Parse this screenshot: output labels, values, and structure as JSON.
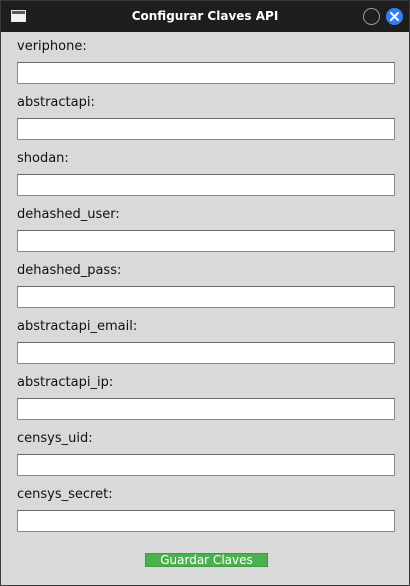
{
  "window": {
    "title": "Configurar Claves API",
    "minimize_icon": "circle-icon",
    "close_icon": "close-icon",
    "close_color": "#2f7ff5"
  },
  "fields": [
    {
      "key": "veriphone",
      "label": "veriphone:",
      "value": ""
    },
    {
      "key": "abstractapi",
      "label": "abstractapi:",
      "value": ""
    },
    {
      "key": "shodan",
      "label": "shodan:",
      "value": ""
    },
    {
      "key": "dehashed_user",
      "label": "dehashed_user:",
      "value": ""
    },
    {
      "key": "dehashed_pass",
      "label": "dehashed_pass:",
      "value": ""
    },
    {
      "key": "abstractapi_email",
      "label": "abstractapi_email:",
      "value": ""
    },
    {
      "key": "abstractapi_ip",
      "label": "abstractapi_ip:",
      "value": ""
    },
    {
      "key": "censys_uid",
      "label": "censys_uid:",
      "value": ""
    },
    {
      "key": "censys_secret",
      "label": "censys_secret:",
      "value": ""
    }
  ],
  "actions": {
    "save_label": "Guardar Claves",
    "save_color": "#4caf50"
  }
}
